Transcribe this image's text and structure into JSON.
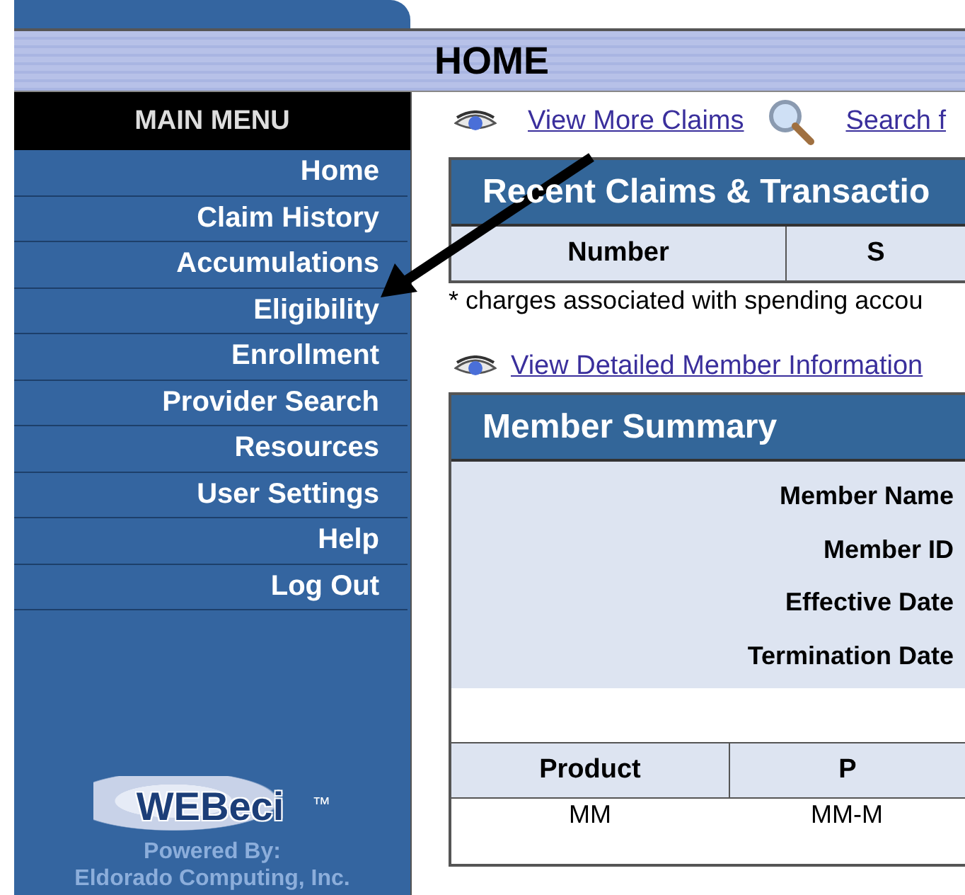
{
  "page_title": "HOME",
  "sidebar": {
    "heading": "MAIN MENU",
    "items": [
      {
        "label": "Home"
      },
      {
        "label": "Claim History"
      },
      {
        "label": "Accumulations"
      },
      {
        "label": "Eligibility"
      },
      {
        "label": "Enrollment"
      },
      {
        "label": "Provider Search"
      },
      {
        "label": "Resources"
      },
      {
        "label": "User Settings"
      },
      {
        "label": "Help"
      },
      {
        "label": "Log Out"
      }
    ],
    "logo": {
      "text": "WEBeci",
      "mark": "™"
    },
    "powered_by": [
      "Powered By:",
      "Eldorado Computing, Inc."
    ]
  },
  "links": [
    {
      "kind": "view",
      "label": "View More Claims"
    },
    {
      "kind": "search",
      "label": "Search f"
    }
  ],
  "claims": {
    "title": "Recent Claims & Transactio",
    "columns": [
      "Number",
      "S"
    ],
    "footnote": "* charges associated with spending accou"
  },
  "member_link": {
    "kind": "view",
    "label": "View Detailed Member Information"
  },
  "member_summary": {
    "title": "Member Summary",
    "fields": [
      "Member Name",
      "Member ID",
      "Effective Date",
      "Termination Date"
    ],
    "columns": [
      "Product",
      "P"
    ],
    "rows": [
      [
        "MM",
        "MM-M"
      ]
    ]
  }
}
